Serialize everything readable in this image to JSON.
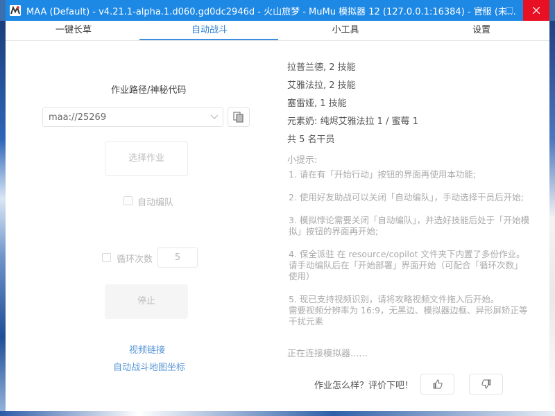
{
  "window": {
    "title": "MAA (Default) - v4.21.1-alpha.1.d060.gd0dc2946d - 火山旅梦 - MuMu 模拟器 12 (127.0.0.1:16384) - 官服 (未…",
    "accent_color": "#1e88e5",
    "close_color": "#e81123"
  },
  "tabs": [
    {
      "label": "一键长草",
      "active": false
    },
    {
      "label": "自动战斗",
      "active": true
    },
    {
      "label": "小工具",
      "active": false
    },
    {
      "label": "设置",
      "active": false
    }
  ],
  "left": {
    "path_label": "作业路径/神秘代码",
    "path_value": "maa://25269",
    "select_button": "选择作业",
    "auto_formation_label": "自动编队",
    "auto_formation_checked": false,
    "loop_label": "循环次数",
    "loop_checked": false,
    "loop_count": "5",
    "stop_button": "停止",
    "video_link": "视频链接",
    "map_coords_link": "自动战斗地图坐标"
  },
  "right": {
    "operators": [
      "拉普兰德, 2 技能",
      "艾雅法拉, 2 技能",
      "塞雷娅, 1 技能",
      "元素奶: 纯烬艾雅法拉 1 / 蜜莓 1",
      "共 5 名干员"
    ],
    "tips_title": "小提示:",
    "tips": [
      "1. 请在有「开始行动」按钮的界面再使用本功能;",
      "2. 使用好友助战可以关闭「自动编队」，手动选择干员后开始;",
      "3. 模拟悖论需要关闭「自动编队」，并选好技能后处于「开始模拟」按钮的界面再开始;",
      "4. 保全派驻 在 resource/copilot 文件夹下内置了多份作业。\n请手动编队后在「开始部署」界面开始（可配合「循环次数」使用）",
      "5. 现已支持视频识别，请将攻略视频文件拖入后开始。\n需要视频分辨率为 16:9，无黑边、模拟器边框、异形屏矫正等干扰元素"
    ],
    "status": "正在连接模拟器......",
    "rating_prompt": "作业怎么样？评价下吧！"
  },
  "icons": {
    "app": "maa-logo-icon",
    "minimize": "minimize-icon",
    "maximize": "maximize-icon",
    "close": "close-icon",
    "dropdown": "chevron-down-icon",
    "paste": "paste-icon",
    "like": "thumbs-up-icon",
    "dislike": "thumbs-down-icon"
  }
}
